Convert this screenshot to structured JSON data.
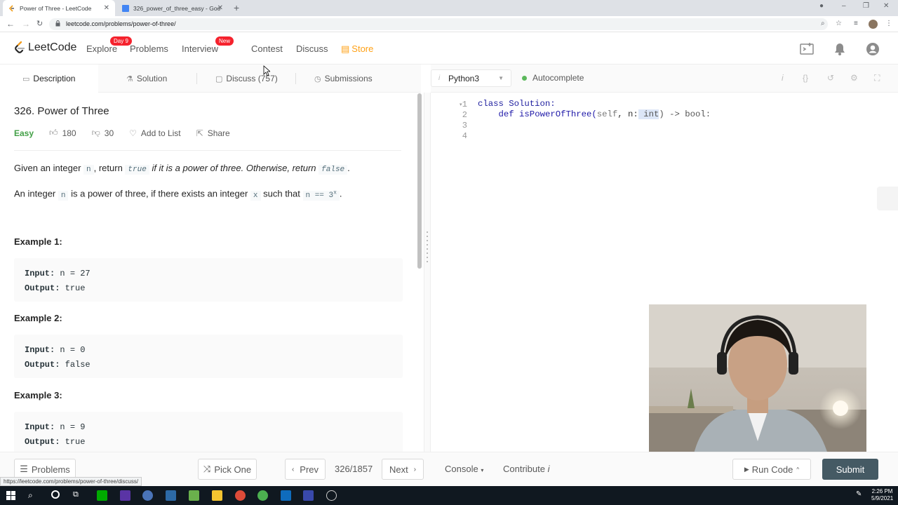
{
  "browser": {
    "tabs": [
      {
        "title": "Power of Three - LeetCode"
      },
      {
        "title": "326_power_of_three_easy - Goo"
      }
    ],
    "url": "leetcode.com/problems/power-of-three/",
    "status_url": "https://leetcode.com/problems/power-of-three/discuss/"
  },
  "nav": {
    "logo": "LeetCode",
    "explore": "Explore",
    "explore_badge": "Day 9",
    "problems": "Problems",
    "interview": "Interview",
    "interview_badge": "New",
    "contest": "Contest",
    "discuss": "Discuss",
    "store": "Store"
  },
  "left_tabs": {
    "description": "Description",
    "solution": "Solution",
    "discuss": "Discuss (757)",
    "submissions": "Submissions"
  },
  "problem": {
    "title": "326. Power of Three",
    "difficulty": "Easy",
    "likes": "180",
    "dislikes": "30",
    "add_to_list": "Add to List",
    "share": "Share",
    "para1": {
      "a": "Given an integer ",
      "code_n": "n",
      "b": ", return ",
      "code_true": "true",
      "c": " if it is a power of three. Otherwise, return ",
      "code_false": "false",
      "d": "."
    },
    "para2": {
      "a": "An integer ",
      "code_n": "n",
      "b": " is a power of three, if there exists an integer ",
      "code_x": "x",
      "c": " such that ",
      "code_eq": "n == 3",
      "sup": "x",
      "d": "."
    },
    "examples": [
      {
        "heading": "Example 1:",
        "input_label": "Input:",
        "input": " n = 27",
        "output_label": "Output:",
        "output": " true"
      },
      {
        "heading": "Example 2:",
        "input_label": "Input:",
        "input": " n = 0",
        "output_label": "Output:",
        "output": " false"
      },
      {
        "heading": "Example 3:",
        "input_label": "Input:",
        "input": " n = 9",
        "output_label": "Output:",
        "output": " true"
      }
    ]
  },
  "editor": {
    "language": "Python3",
    "autocomplete": "Autocomplete",
    "line_numbers": [
      "1",
      "2",
      "3",
      "4"
    ],
    "line1": "class Solution:",
    "line2": {
      "indent": "    ",
      "def": "def",
      "fn": " isPowerOfThree(",
      "self": "self",
      "mid": ", n:",
      "int": " int",
      "end": ") -> bool:"
    }
  },
  "bottom": {
    "problems": "Problems",
    "pick_one": "Pick One",
    "prev": "Prev",
    "page": "326/1857",
    "next": "Next",
    "console": "Console",
    "contribute": "Contribute",
    "run_code": "Run Code",
    "submit": "Submit"
  },
  "taskbar": {
    "time": "2:26 PM",
    "date": "5/9/2021"
  },
  "colors": {
    "brand": "#ffa116",
    "easy": "#43a047",
    "badge": "#f5222d",
    "submit": "#455a64",
    "autocomplete_dot": "#5cb85c"
  }
}
